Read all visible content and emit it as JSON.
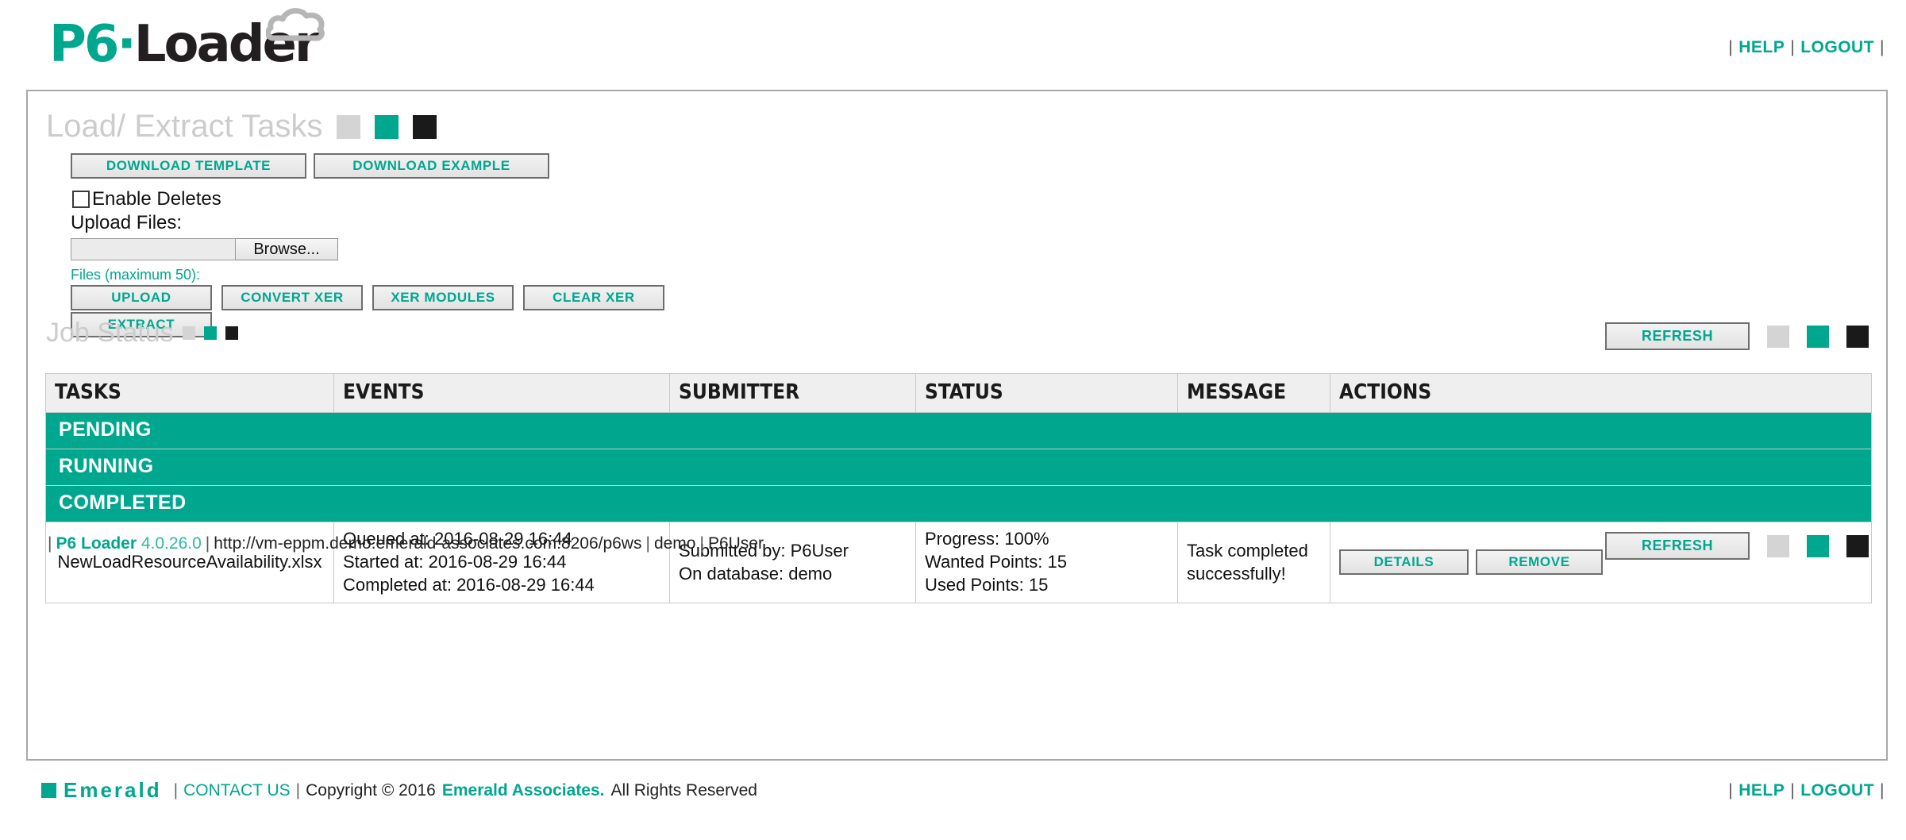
{
  "header": {
    "logo": {
      "p6": "P6",
      "dot": "·",
      "loader": "Loader",
      "cloud_icon": "cloud-icon"
    },
    "links": {
      "help": "HELP",
      "logout": "LOGOUT",
      "separator": "|"
    }
  },
  "tasks_section": {
    "title": "Load/ Extract Tasks",
    "download_template": "DOWNLOAD TEMPLATE",
    "download_example": "DOWNLOAD EXAMPLE",
    "enable_deletes_label": "Enable Deletes",
    "enable_deletes_checked": false,
    "upload_files_label": "Upload Files:",
    "file_input_value": "",
    "browse_label": "Browse...",
    "files_max_label": "Files (maximum 50):",
    "buttons": {
      "upload": "UPLOAD",
      "convert_xer": "CONVERT XER",
      "xer_modules": "XER MODULES",
      "clear_xer": "CLEAR XER",
      "extract": "EXTRACT"
    }
  },
  "job_status": {
    "title": "Job Status",
    "refresh_label": "REFRESH",
    "table": {
      "columns": [
        "TASKS",
        "EVENTS",
        "SUBMITTER",
        "STATUS",
        "MESSAGE",
        "ACTIONS"
      ],
      "sections": {
        "pending": "PENDING",
        "running": "RUNNING",
        "completed": "COMPLETED"
      },
      "rows": [
        {
          "task": "NewLoadResourceAvailability.xlsx",
          "events": {
            "queued": "Queued at: 2016-08-29 16:44",
            "started": "Started at: 2016-08-29 16:44",
            "completed": "Completed at: 2016-08-29 16:44"
          },
          "submitter": {
            "by": "Submitted by: P6User",
            "database": "On database: demo"
          },
          "status": {
            "progress": "Progress: 100%",
            "wanted_points": "Wanted Points: 15",
            "used_points": "Used Points: 15"
          },
          "message": "Task completed successfully!",
          "actions": {
            "details": "DETAILS",
            "remove": "REMOVE"
          }
        }
      ]
    }
  },
  "status_bar": {
    "lead_sep": "|",
    "product": "P6 Loader",
    "version": "4.0.26.0",
    "url": "http://vm-eppm.demo.emerald-associates.com:8206/p6ws",
    "database": "demo",
    "user": "P6User"
  },
  "footer": {
    "emerald_word": "Emerald",
    "contact_us": "CONTACT US",
    "copyright_prefix": "Copyright © 2016",
    "company": "Emerald Associates.",
    "rights": "All Rights Reserved",
    "help": "HELP",
    "logout": "LOGOUT"
  },
  "colors": {
    "teal": "#00a78f",
    "dark": "#1a1a1a",
    "gray_square": "#d4d4d4",
    "title_gray": "#cccccc"
  }
}
